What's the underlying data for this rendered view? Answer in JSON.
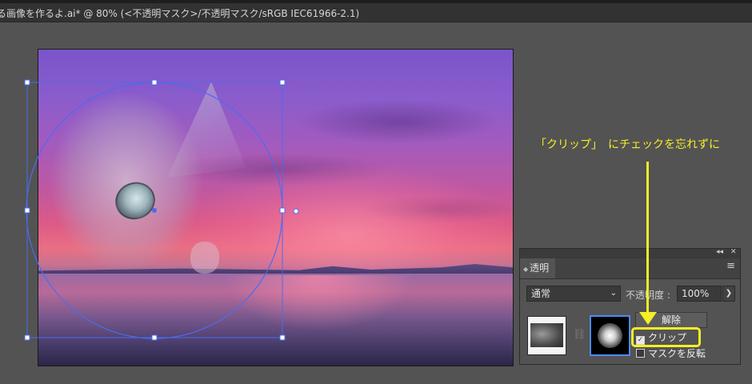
{
  "window": {
    "document_title": "る画像を作るよ.ai* @ 80% (<不透明マスク>/不透明マスク/sRGB IEC61966-2.1)"
  },
  "colors": {
    "annotation": "#f6ee25",
    "selection": "#4a6cf0",
    "panel_bg": "#535353",
    "canvas_bg": "#535353"
  },
  "transparency_panel": {
    "tab_label": "透明",
    "blend_mode": "通常",
    "opacity_label": "不透明度 :",
    "opacity_value": "100%",
    "release_button": "解除",
    "clip_label": "クリップ",
    "clip_checked": true,
    "invert_mask_label": "マスクを反転",
    "invert_mask_checked": false,
    "icons": {
      "collapse": "double-chevron-icon",
      "close": "close-icon",
      "menu": "hamburger-icon",
      "link": "link-icon",
      "stepper": "chevron-right-icon"
    }
  },
  "annotation": {
    "text": "「クリップ」　にチェックを忘れずに"
  }
}
